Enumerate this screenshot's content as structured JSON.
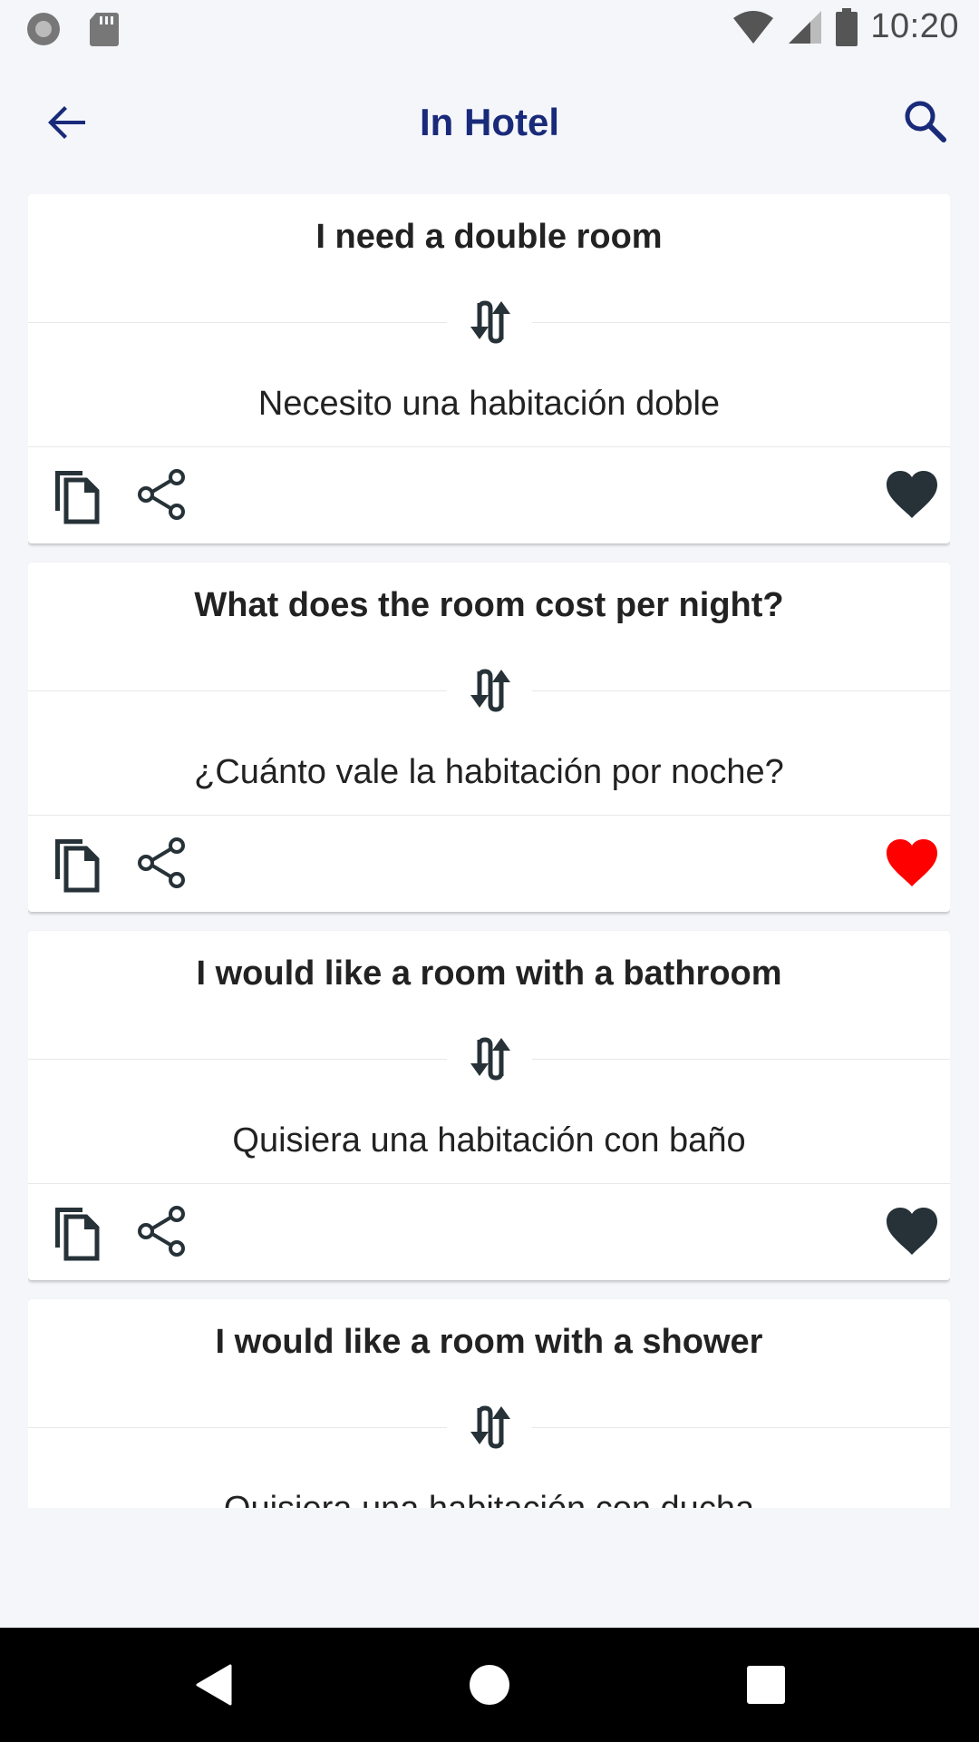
{
  "status_bar": {
    "time": "10:20",
    "icons": [
      "record-icon",
      "sd-card-icon",
      "wifi-icon",
      "signal-icon",
      "battery-icon"
    ]
  },
  "app_bar": {
    "title": "In Hotel",
    "back_icon": "arrow-back-icon",
    "search_icon": "search-icon"
  },
  "phrases": [
    {
      "source": "I need a double room",
      "target": "Necesito una habitación doble",
      "favorite": false
    },
    {
      "source": "What does the room cost per night?",
      "target": "¿Cuánto vale la habitación por noche?",
      "favorite": true
    },
    {
      "source": "I would like a room with a bathroom",
      "target": "Quisiera una habitación con baño",
      "favorite": false
    },
    {
      "source": "I would like a room with a shower",
      "target": "Quisiera una habitación con ducha",
      "favorite": false
    }
  ],
  "colors": {
    "accent": "#1a2a7a",
    "favorite_on": "#ff0000",
    "favorite_off": "#263238",
    "icon": "#263238"
  },
  "nav_bar": {
    "buttons": [
      "back-nav-icon",
      "home-nav-icon",
      "recents-nav-icon"
    ]
  }
}
